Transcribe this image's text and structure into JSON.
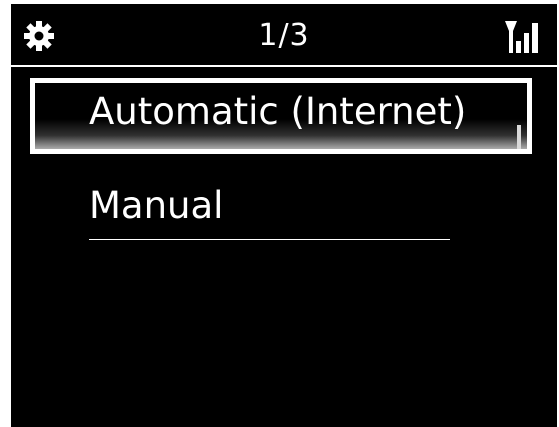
{
  "header": {
    "page_indicator": "1/3",
    "left_icon": "settings-gear-icon",
    "right_icon": "signal-strength-icon"
  },
  "menu": {
    "items": [
      {
        "label": "Automatic (Internet)",
        "selected": true
      },
      {
        "label": "Manual",
        "selected": false
      }
    ]
  },
  "colors": {
    "background": "#000000",
    "foreground": "#ffffff"
  }
}
